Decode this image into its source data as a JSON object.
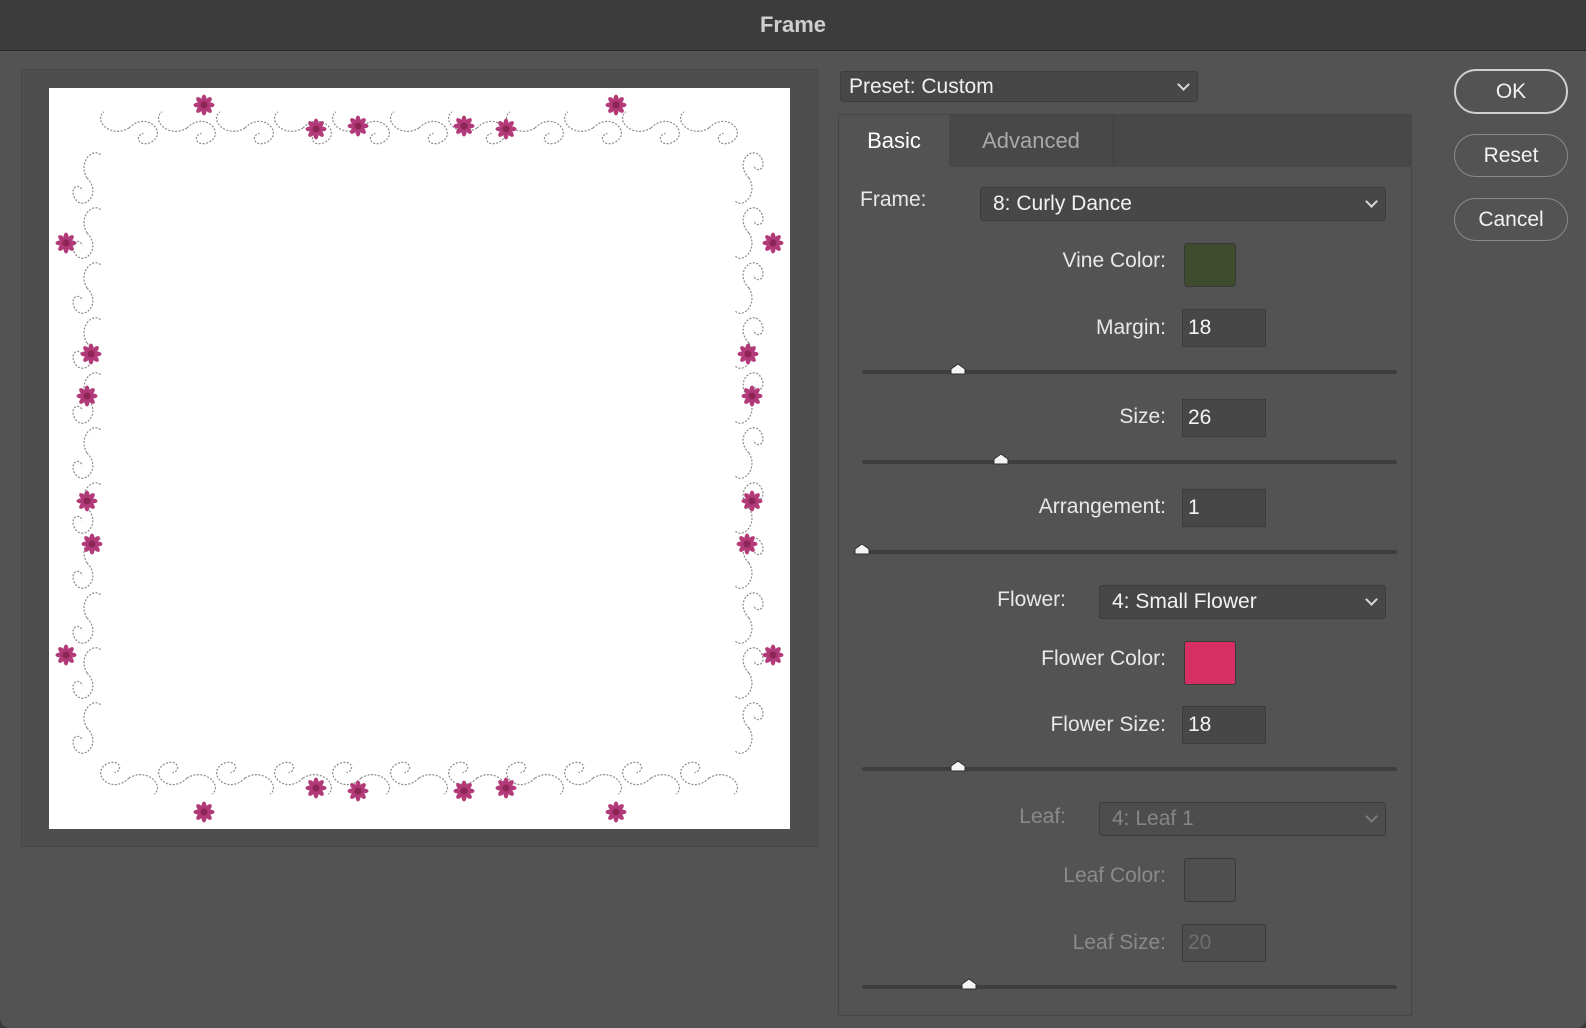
{
  "window": {
    "title": "Frame"
  },
  "preset": {
    "label": "Preset: Custom"
  },
  "buttons": {
    "ok": "OK",
    "reset": "Reset",
    "cancel": "Cancel"
  },
  "tabs": {
    "basic": "Basic",
    "advanced": "Advanced",
    "active": "Basic"
  },
  "basic": {
    "frame_label": "Frame:",
    "frame_value": "8: Curly Dance",
    "vine_color_label": "Vine Color:",
    "vine_color": "#3f4d2e",
    "margin_label": "Margin:",
    "margin_value": "18",
    "margin_slider": 0.18,
    "size_label": "Size:",
    "size_value": "26",
    "size_slider": 0.26,
    "arrangement_label": "Arrangement:",
    "arrangement_value": "1",
    "arrangement_slider": 0.0,
    "flower_label": "Flower:",
    "flower_value": "4: Small Flower",
    "flower_color_label": "Flower Color:",
    "flower_color": "#d62f63",
    "flower_size_label": "Flower Size:",
    "flower_size_value": "18",
    "flower_size_slider": 0.18,
    "leaf_label": "Leaf:",
    "leaf_value": "4: Leaf 1",
    "leaf_color_label": "Leaf Color:",
    "leaf_color": "#4f4f4f",
    "leaf_size_label": "Leaf Size:",
    "leaf_size_value": "20",
    "leaf_size_slider": 0.2
  },
  "colors": {
    "flower_preview": "#b23a78",
    "vine_preview": "#8a8a8a"
  }
}
